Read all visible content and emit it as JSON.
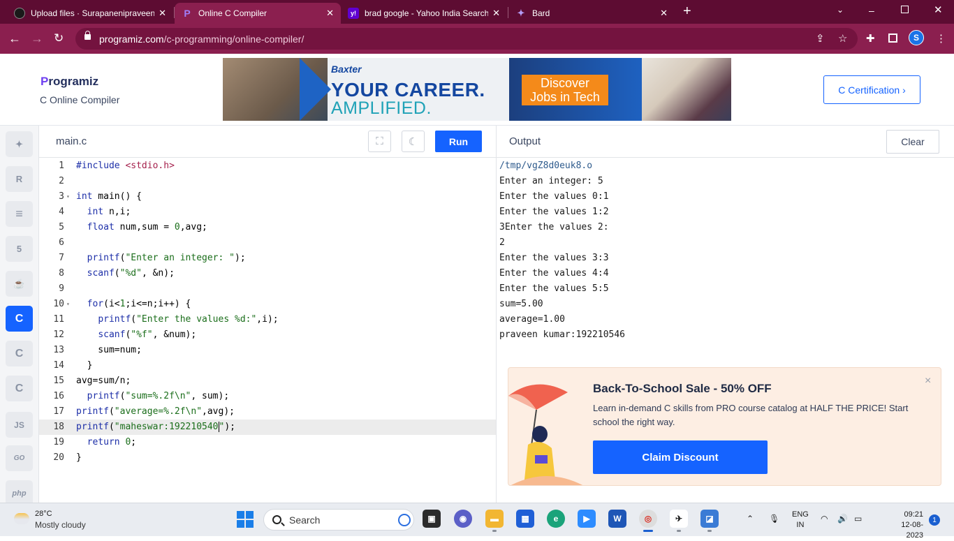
{
  "browser": {
    "tabs": [
      {
        "title": "Upload files · Surapanenipraveenk",
        "favicon": "github-icon",
        "active": false
      },
      {
        "title": "Online C Compiler",
        "favicon": "programiz-icon",
        "active": true
      },
      {
        "title": "brad google - Yahoo India Search",
        "favicon": "yahoo-icon",
        "active": false
      },
      {
        "title": "Bard",
        "favicon": "bard-icon",
        "active": false
      }
    ],
    "new_tab": "+",
    "url_host": "programiz.com",
    "url_path": "/c-programming/online-compiler/",
    "profile_initial": "S"
  },
  "header": {
    "logo_p": "P",
    "logo_rest": "rogramiz",
    "subtitle": "C Online Compiler",
    "ad": {
      "brand": "Baxter",
      "line1": "YOUR CAREER.",
      "line2": "AMPLIFIED.",
      "cta_line1": "Discover",
      "cta_line2": "Jobs in Tech"
    },
    "cert_button": "C Certification ›"
  },
  "sidebar": {
    "languages": [
      {
        "name": "python",
        "label": "✦"
      },
      {
        "name": "r",
        "label": "R"
      },
      {
        "name": "sql",
        "label": "≡"
      },
      {
        "name": "html",
        "label": "5"
      },
      {
        "name": "java",
        "label": "☕"
      },
      {
        "name": "c",
        "label": "C"
      },
      {
        "name": "cpp",
        "label": "C"
      },
      {
        "name": "csharp",
        "label": "C"
      },
      {
        "name": "js",
        "label": "JS"
      },
      {
        "name": "go",
        "label": "GO"
      },
      {
        "name": "php",
        "label": "php"
      }
    ]
  },
  "editor": {
    "file_name": "main.c",
    "run_label": "Run",
    "highlight_line": 18
  },
  "output": {
    "title": "Output",
    "clear_label": "Clear",
    "lines": [
      "/tmp/vgZ8d0euk8.o",
      "Enter an integer: 5",
      "Enter the values 0:1",
      "Enter the values 1:2",
      "3Enter the values 2:",
      "2",
      "Enter the values 3:3",
      "Enter the values 4:4",
      "Enter the values 5:5",
      "sum=5.00",
      "average=1.00",
      "praveen kumar:192210546"
    ]
  },
  "promo": {
    "title": "Back-To-School Sale - 50% OFF",
    "description": "Learn in-demand C skills from PRO course catalog at HALF THE PRICE! Start school the right way.",
    "cta": "Claim Discount",
    "close": "×"
  },
  "taskbar": {
    "temperature": "28°C",
    "weather": "Mostly cloudy",
    "search_placeholder": "Search",
    "lang_line1": "ENG",
    "lang_line2": "IN",
    "time": "09:21",
    "date": "12-08-2023",
    "notifications": "1"
  },
  "colors": {
    "accent": "#1563ff",
    "titlebar": "#5d0c32",
    "toolbar": "#8b1f4f"
  }
}
